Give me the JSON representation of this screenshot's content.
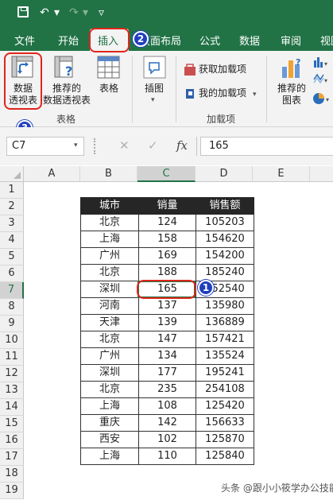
{
  "quick_access": {
    "save_icon": "save-icon",
    "undo_glyph": "↶",
    "redo_glyph": "↷",
    "dropdown_glyph": "▾",
    "customize_glyph": "▿"
  },
  "tabs": [
    "文件",
    "开始",
    "插入",
    "页面布局",
    "公式",
    "数据",
    "审阅",
    "视图"
  ],
  "active_tab": "插入",
  "ribbon": {
    "pivot_table": "数据\n透视表",
    "recommended_pivot": "推荐的\n数据透视表",
    "table": "表格",
    "illustrations": "插图",
    "get_addins": "获取加载项",
    "my_addins": "我的加载项",
    "recommended_charts": "推荐的\n图表",
    "group_tables": "表格",
    "group_addins": "加载项"
  },
  "badges": {
    "step1": "1",
    "step2": "2",
    "step3": "3"
  },
  "formula_bar": {
    "name_box": "C7",
    "cancel": "✕",
    "enter": "✓",
    "fx": "fx",
    "value": "165"
  },
  "columns": [
    "A",
    "B",
    "C",
    "D",
    "E"
  ],
  "rows": [
    "1",
    "2",
    "3",
    "4",
    "5",
    "6",
    "7",
    "8",
    "9",
    "10",
    "11",
    "12",
    "13",
    "14",
    "15",
    "16",
    "17",
    "18",
    "19"
  ],
  "table": {
    "headers": [
      "城市",
      "销量",
      "销售额"
    ],
    "rows": [
      [
        "北京",
        "124",
        "105203"
      ],
      [
        "上海",
        "158",
        "154620"
      ],
      [
        "广州",
        "169",
        "154200"
      ],
      [
        "北京",
        "188",
        "185240"
      ],
      [
        "深圳",
        "165",
        "152540"
      ],
      [
        "河南",
        "137",
        "135980"
      ],
      [
        "天津",
        "139",
        "136889"
      ],
      [
        "北京",
        "147",
        "157421"
      ],
      [
        "广州",
        "134",
        "135524"
      ],
      [
        "深圳",
        "177",
        "195241"
      ],
      [
        "北京",
        "235",
        "254108"
      ],
      [
        "上海",
        "108",
        "125420"
      ],
      [
        "重庆",
        "142",
        "156633"
      ],
      [
        "西安",
        "102",
        "125870"
      ],
      [
        "上海",
        "110",
        "125840"
      ]
    ]
  },
  "watermark": "头条 @跟小小筱学办公技能",
  "colors": {
    "excel_green": "#217346",
    "highlight_red": "#e0251b",
    "badge_blue": "#1f3fbf"
  }
}
